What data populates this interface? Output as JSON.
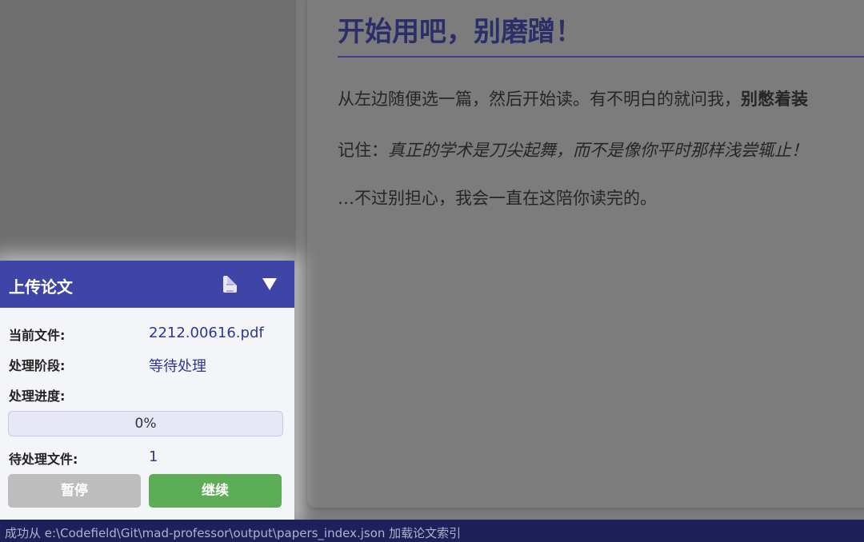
{
  "content": {
    "title": "开始用吧，别磨蹭！",
    "para1_prefix": "从左边随便选一篇，然后开始读。有不明白的就问我，",
    "para1_bold": "别憋着装",
    "para2_prefix": "记住：",
    "para2_italic": "真正的学术是刀尖起舞，而不是像你平时那样浅尝辄止！",
    "para3": "…不过别担心，我会一直在这陪你读完的。"
  },
  "upload": {
    "title": "上传论文",
    "current_file_label": "当前文件:",
    "current_file_value": "2212.00616.pdf",
    "stage_label": "处理阶段:",
    "stage_value": "等待处理",
    "progress_label": "处理进度:",
    "progress_text": "0%",
    "progress_value": 0,
    "pending_label": "待处理文件:",
    "pending_value": "1",
    "pause_button": "暂停",
    "continue_button": "继续",
    "icons": {
      "document": "document-icon",
      "collapse": "triangle-down-icon"
    }
  },
  "status_bar": {
    "text": "成功从 e:\\Codefield\\Git\\mad-professor\\output\\papers_index.json 加载论文索引"
  },
  "colors": {
    "accent": "#3f45a6",
    "continue": "#5cad56",
    "pause": "#bdbdbd",
    "status_bar": "#1e2059"
  }
}
